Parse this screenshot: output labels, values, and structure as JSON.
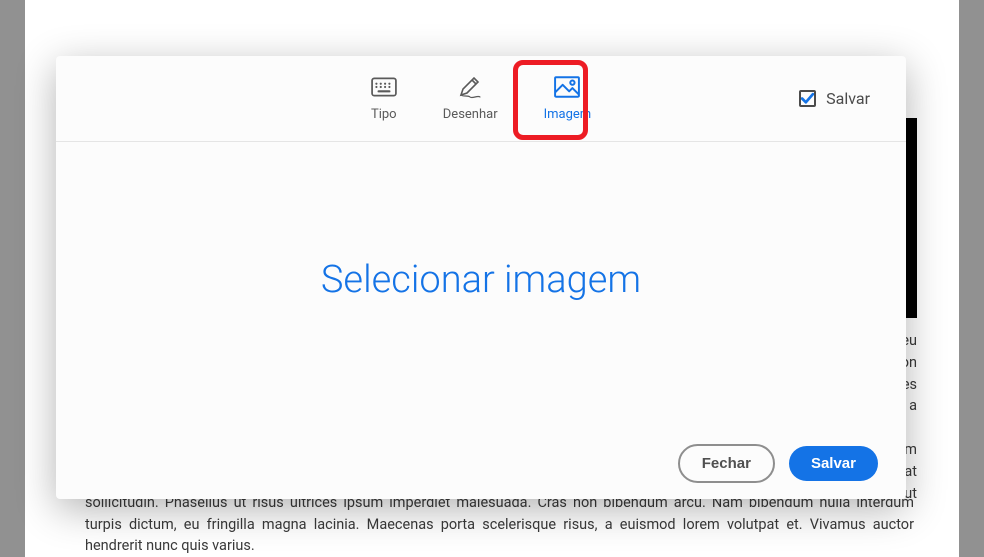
{
  "tabs": {
    "tipo": {
      "label": "Tipo"
    },
    "desenhar": {
      "label": "Desenhar"
    },
    "imagem": {
      "label": "Imagem"
    }
  },
  "header": {
    "save_checkbox_label": "Salvar"
  },
  "body": {
    "select_image": "Selecionar imagem"
  },
  "footer": {
    "close": "Fechar",
    "save": "Salvar"
  },
  "background": {
    "partial_lines": {
      "l1": "m eu",
      "l2": "non",
      "l3": "rices",
      "l4": "elit, a",
      "l5": "Nam",
      "l6": "erat",
      "l7": "la ut"
    },
    "body_text": "sollicitudin. Phasellus ut risus ultrices ipsum imperdiet malesuada. Cras non bibendum arcu. Nam bibendum nulla interdum turpis dictum, eu fringilla magna lacinia. Maecenas porta scelerisque risus, a euismod lorem volutpat et. Vivamus auctor hendrerit nunc quis varius."
  }
}
